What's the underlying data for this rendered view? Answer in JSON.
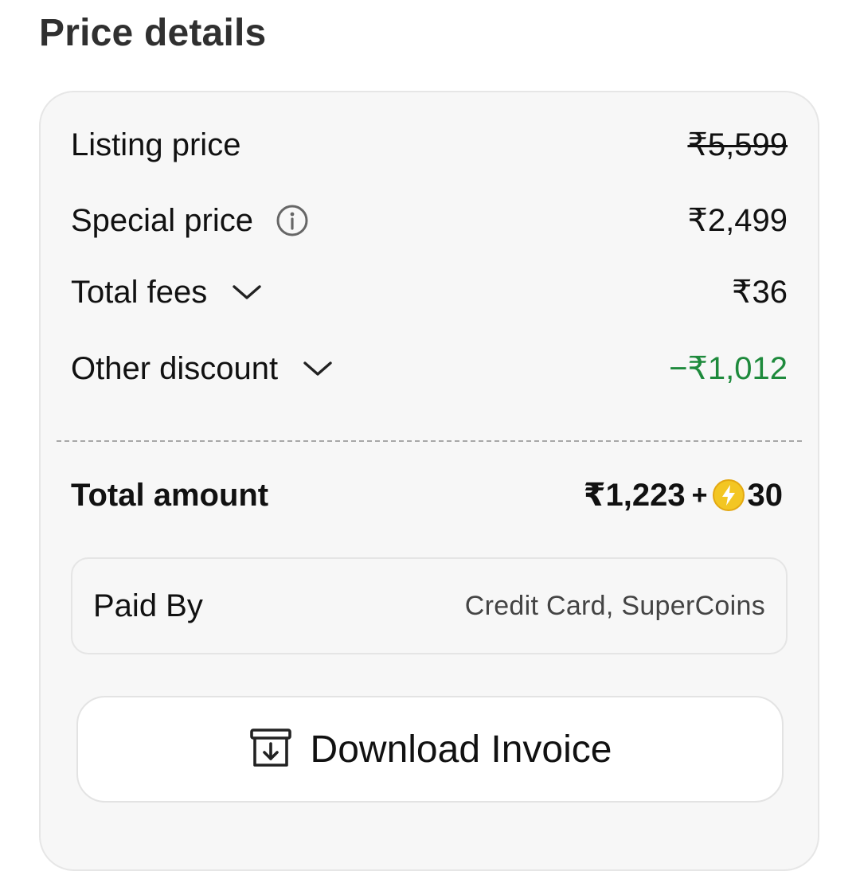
{
  "header": {
    "title": "Price details"
  },
  "rows": [
    {
      "label": "Listing price",
      "value": "₹5,599"
    },
    {
      "label": "Special price",
      "value": "₹2,499"
    },
    {
      "label": "Total fees",
      "value": "₹36"
    },
    {
      "label": "Other discount",
      "value": "−₹1,012"
    }
  ],
  "total": {
    "label": "Total amount",
    "amount": "₹1,223",
    "plus": "+",
    "coins": "30"
  },
  "payment": {
    "label": "Paid By",
    "value": "Credit Card, SuperCoins"
  },
  "invoice": {
    "label": "Download Invoice"
  },
  "colors": {
    "discount_green": "#1e8a3c",
    "coin_yellow": "#f3c623",
    "card_bg": "#f7f7f7"
  },
  "icons": {
    "special_price": "info-icon",
    "total_fees": "chevron-down-icon",
    "other_discount": "chevron-down-icon",
    "coin": "supercoin-icon",
    "invoice": "download-box-icon"
  }
}
